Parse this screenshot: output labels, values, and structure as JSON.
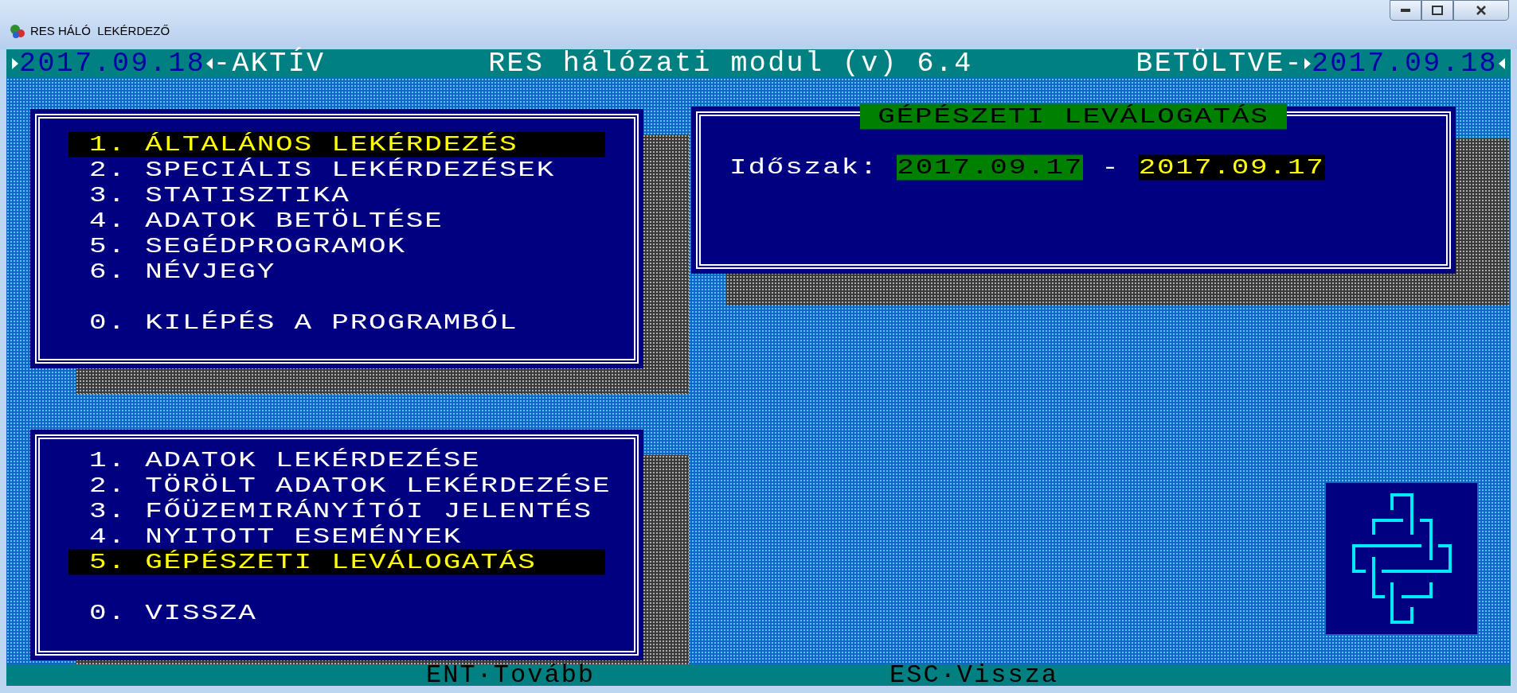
{
  "window": {
    "title": "RES HÁLÓ  LEKÉRDEZŐ"
  },
  "status_bar": {
    "active_date": "2017.09.18",
    "active_label": "-AKTÍV",
    "title": "RES hálózati modul (v) 6.4",
    "loaded_label": "BETÖLTVE-",
    "loaded_date": "2017.09.18"
  },
  "main_menu": {
    "items": [
      {
        "number": "1.",
        "label": "ÁLTALÁNOS LEKÉRDEZÉS",
        "selected": true
      },
      {
        "number": "2.",
        "label": "SPECIÁLIS LEKÉRDEZÉSEK",
        "selected": false
      },
      {
        "number": "3.",
        "label": "STATISZTIKA",
        "selected": false
      },
      {
        "number": "4.",
        "label": "ADATOK BETÖLTÉSE",
        "selected": false
      },
      {
        "number": "5.",
        "label": "SEGÉDPROGRAMOK",
        "selected": false
      },
      {
        "number": "6.",
        "label": "NÉVJEGY",
        "selected": false
      },
      {
        "number": "0.",
        "label": "KILÉPÉS A PROGRAMBÓL",
        "selected": false,
        "kind": "exit"
      }
    ]
  },
  "sub_menu": {
    "items": [
      {
        "number": "1.",
        "label": "ADATOK LEKÉRDEZÉSE",
        "selected": false
      },
      {
        "number": "2.",
        "label": "TÖRÖLT ADATOK LEKÉRDEZÉSE",
        "selected": false
      },
      {
        "number": "3.",
        "label": "FŐÜZEMIRÁNYÍTÓI JELENTÉS",
        "selected": false
      },
      {
        "number": "4.",
        "label": "NYITOTT ESEMÉNYEK",
        "selected": false
      },
      {
        "number": "5.",
        "label": "GÉPÉSZETI LEVÁLOGATÁS",
        "selected": true
      },
      {
        "number": "0.",
        "label": "VISSZA",
        "selected": false,
        "kind": "exit"
      }
    ]
  },
  "filter_panel": {
    "title": "GÉPÉSZETI LEVÁLOGATÁS",
    "period_label": "Időszak:",
    "from": {
      "value": "2017.09.17",
      "focused": false
    },
    "separator": "-",
    "to": {
      "value": "2017.09.17",
      "focused": true
    }
  },
  "footer": {
    "hints": [
      "ENT·Tovább",
      "ESC·Vissza"
    ]
  }
}
